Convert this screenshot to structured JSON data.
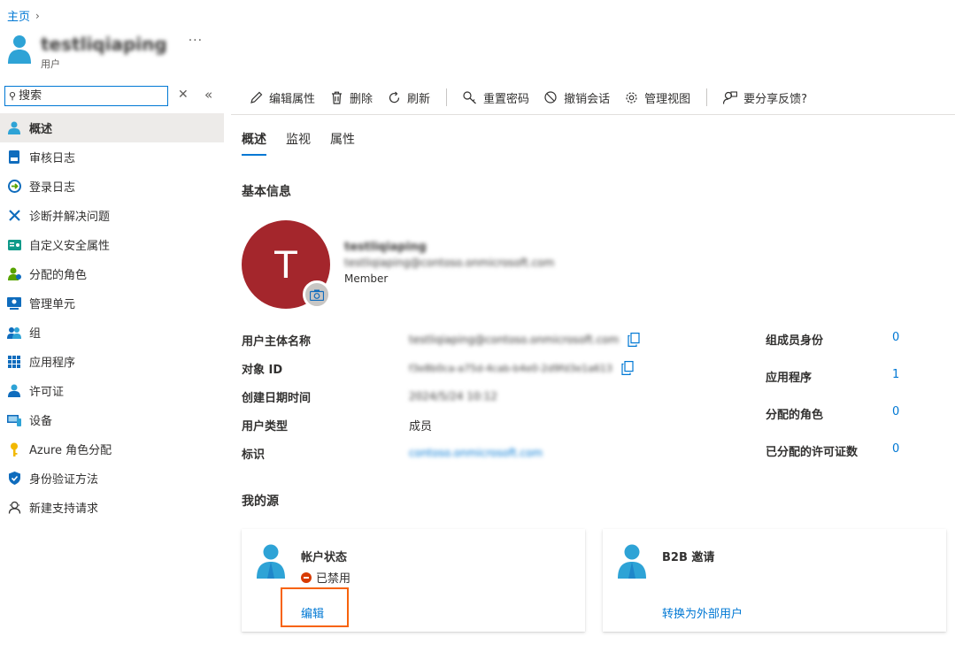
{
  "breadcrumb": {
    "home": "主页"
  },
  "header": {
    "title": "testliqiaping",
    "subtitle": "用户",
    "more": "···"
  },
  "search": {
    "placeholder": "搜索"
  },
  "sidebar": {
    "items": [
      {
        "label": "概述",
        "icon": "user-icon"
      },
      {
        "label": "审核日志",
        "icon": "audit-log-icon"
      },
      {
        "label": "登录日志",
        "icon": "sign-in-log-icon"
      },
      {
        "label": "诊断并解决问题",
        "icon": "wrench-icon"
      },
      {
        "label": "自定义安全属性",
        "icon": "security-attributes-icon"
      },
      {
        "label": "分配的角色",
        "icon": "assigned-roles-icon"
      },
      {
        "label": "管理单元",
        "icon": "admin-units-icon"
      },
      {
        "label": "组",
        "icon": "groups-icon"
      },
      {
        "label": "应用程序",
        "icon": "apps-grid-icon"
      },
      {
        "label": "许可证",
        "icon": "license-icon"
      },
      {
        "label": "设备",
        "icon": "devices-icon"
      },
      {
        "label": "Azure 角色分配",
        "icon": "key-icon"
      },
      {
        "label": "身份验证方法",
        "icon": "shield-icon"
      },
      {
        "label": "新建支持请求",
        "icon": "support-icon"
      }
    ]
  },
  "toolbar": {
    "edit": "编辑属性",
    "delete": "删除",
    "refresh": "刷新",
    "reset_password": "重置密码",
    "revoke_sessions": "撤销会话",
    "manage_view": "管理视图",
    "feedback": "要分享反馈?"
  },
  "tabs": [
    "概述",
    "监视",
    "属性"
  ],
  "basic_info": {
    "title": "基本信息",
    "avatar_letter": "T",
    "display_name": "testliqiaping",
    "email": "testliqiaping@contoso.onmicrosoft.com",
    "member": "Member"
  },
  "properties": [
    {
      "label": "用户主体名称",
      "value": "testliqiaping@contoso.onmicrosoft.com",
      "blurred": true,
      "copy": true
    },
    {
      "label": "对象 ID",
      "value": "f3e8b0ca-a75d-4cab-b4e0-2d9fd3e1a613",
      "blurred": true,
      "copy": true
    },
    {
      "label": "创建日期时间",
      "value": "2024/5/24 10:12",
      "blurred": true,
      "copy": false
    },
    {
      "label": "用户类型",
      "value": "成员",
      "blurred": false,
      "copy": false
    },
    {
      "label": "标识",
      "value": "contoso.onmicrosoft.com",
      "blurred": true,
      "copy": false
    }
  ],
  "stats": [
    {
      "label": "组成员身份",
      "value": "0"
    },
    {
      "label": "应用程序",
      "value": "1"
    },
    {
      "label": "分配的角色",
      "value": "0"
    },
    {
      "label": "已分配的许可证数",
      "value": "0"
    }
  ],
  "my_feed": {
    "title": "我的源",
    "account_status": {
      "title": "帐户状态",
      "status": "已禁用",
      "link": "编辑"
    },
    "b2b": {
      "title": "B2B 邀请",
      "link": "转换为外部用户"
    }
  },
  "colors": {
    "accent": "#0078d4",
    "avatar": "#a4262c",
    "highlight": "#f7630c",
    "disabled": "#d83b01"
  }
}
